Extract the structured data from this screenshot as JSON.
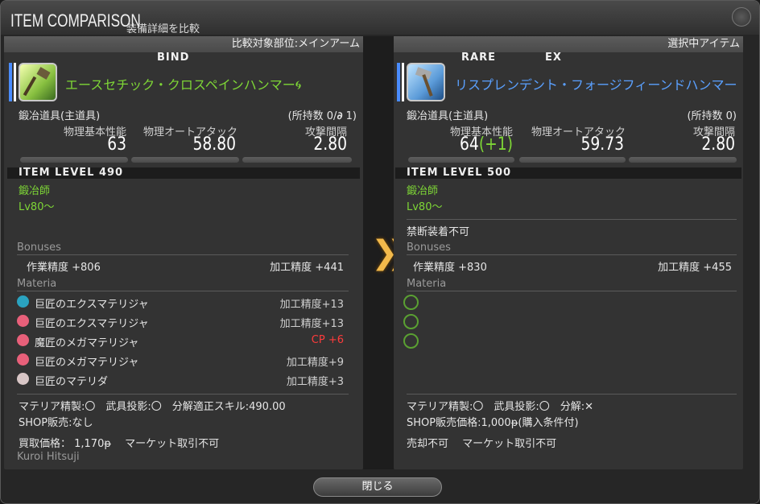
{
  "window": {
    "title": "ITEM COMPARISON",
    "subtitle": "装備詳細を比較"
  },
  "left": {
    "header": "比較対象部位:メインアーム",
    "flags": "BIND",
    "name": "エースセチック・クロスペインハンマー",
    "category": "鍛冶道具(主道具)",
    "owned": "(所持数 0/",
    "owned_end": " 1)",
    "stats": [
      {
        "label": "物理基本性能",
        "value": "63"
      },
      {
        "label": "物理オートアタック",
        "value": "58.80"
      },
      {
        "label": "攻撃間隔",
        "value": "2.80"
      }
    ],
    "item_level": "ITEM LEVEL 490",
    "job": "鍛冶師",
    "level": "Lv80～",
    "bonuses_title": "Bonuses",
    "bonuses": [
      "作業精度 +806",
      "加工精度 +441"
    ],
    "materia_title": "Materia",
    "materia": [
      {
        "name": "巨匠のエクスマテリジャ",
        "effect": "加工精度+13",
        "color": "#2aa3c0"
      },
      {
        "name": "巨匠のエクスマテリジャ",
        "effect": "加工精度+13",
        "color": "#e8607a"
      },
      {
        "name": "魔匠のメガマテリジャ",
        "effect": "CP +6",
        "color": "#e8607a"
      },
      {
        "name": "巨匠のメガマテリジャ",
        "effect": "加工精度+9",
        "color": "#e8607a"
      },
      {
        "name": "巨匠のマテリダ",
        "effect": "加工精度+3",
        "color": "#d8c6c6"
      }
    ],
    "info1": "マテリア精製:〇　武具投影:〇　分解適正スキル:490.00",
    "info2": "SHOP販売:なし",
    "info3": "買取価格： 1,170ᵽ　 マーケット取引不可",
    "crafter": "Kuroi Hitsuji"
  },
  "right": {
    "header": "選択中アイテム",
    "flags_rare": "RARE",
    "flags_ex": "EX",
    "name": "リスプレンデント・フォージフィーンドハンマー",
    "category": "鍛冶道具(主道具)",
    "owned": "(所持数 0)",
    "stats": [
      {
        "label": "物理基本性能",
        "value": "64",
        "diff": "(+1)"
      },
      {
        "label": "物理オートアタック",
        "value": "59.73"
      },
      {
        "label": "攻撃間隔",
        "value": "2.80"
      }
    ],
    "item_level": "ITEM LEVEL 500",
    "job": "鍛冶師",
    "level": "Lv80～",
    "restriction": "禁断装着不可",
    "bonuses_title": "Bonuses",
    "bonuses": [
      "作業精度 +830",
      "加工精度 +455"
    ],
    "materia_title": "Materia",
    "info1": "マテリア精製:〇　武具投影:〇　分解:✕",
    "info2": "SHOP販売価格:1,000ᵽ(購入条件付)",
    "info3": "売却不可　 マーケット取引不可"
  },
  "close_label": "閉じる",
  "colors": {
    "green": "#7ed636",
    "name_left": "#7ed636",
    "name_right": "#5aa0ff",
    "cp": "#ff3b3b",
    "arrow": "#f2b94b"
  }
}
